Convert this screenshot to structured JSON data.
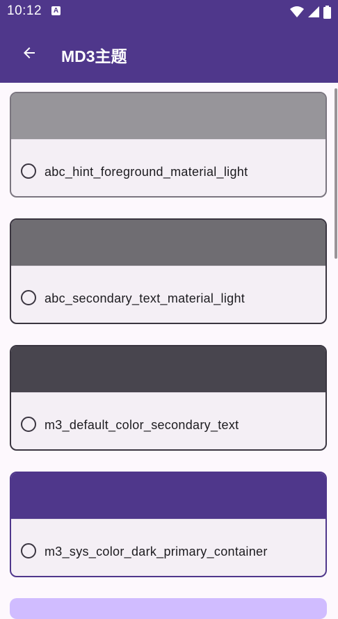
{
  "status_bar": {
    "time": "10:12",
    "notification_badge": "A"
  },
  "app_bar": {
    "title": "MD3主题"
  },
  "cards": [
    {
      "label": "abc_hint_foreground_material_light",
      "color": "#97959a",
      "border": "#7a757f"
    },
    {
      "label": "abc_secondary_text_material_light",
      "color": "#6f6d72",
      "border": "#3a3540"
    },
    {
      "label": "m3_default_color_secondary_text",
      "color": "#48454e",
      "border": "#3a3540"
    },
    {
      "label": "m3_sys_color_dark_primary_container",
      "color": "#4f378b",
      "border": "#4f378b"
    }
  ],
  "next_card_color": "#d0bcff"
}
